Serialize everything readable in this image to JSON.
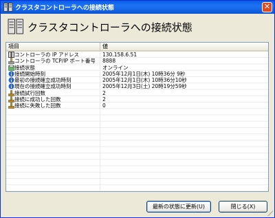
{
  "window": {
    "title": "クラスタコントローラへの接続状態",
    "close_glyph": "✕"
  },
  "header": {
    "title": "クラスタコントローラへの接続状態",
    "icon": "server-rack-icon"
  },
  "table": {
    "columns": [
      "項目",
      "値"
    ],
    "rows": [
      {
        "icon": "server-icon",
        "label": "コントローラの IP アドレス",
        "value": "130.158.6.51"
      },
      {
        "icon": "network-port-icon",
        "label": "コントローラの TCP/IP ポート番号",
        "value": "8888"
      },
      {
        "icon": "connection-status-icon",
        "label": "接続状態",
        "value": "オンライン"
      },
      {
        "icon": "info-icon",
        "label": "接続開始時刻",
        "value": "2005年12月1日(木) 10時36分 9秒"
      },
      {
        "icon": "info-icon",
        "label": "最初の接続確立成功時刻",
        "value": "2005年12月1日(木) 10時36分10秒"
      },
      {
        "icon": "info-icon",
        "label": "現在の接続確立成功時刻",
        "value": "2005年12月3日(土) 20時19分59秒"
      },
      {
        "icon": "counter-icon",
        "label": "接続試行回数",
        "value": "2"
      },
      {
        "icon": "counter-icon",
        "label": "接続に成功した回数",
        "value": "2"
      },
      {
        "icon": "counter-icon",
        "label": "接続に失敗した回数",
        "value": "0"
      }
    ]
  },
  "buttons": {
    "refresh_label": "最新の状態に更新(U)",
    "close_label": "閉じる(X)"
  },
  "colors": {
    "titlebar": "#0a5ee6",
    "dialog_bg": "#ece9d8",
    "info_icon": "#2a66d3",
    "counter_icon": "#b88a2e"
  }
}
